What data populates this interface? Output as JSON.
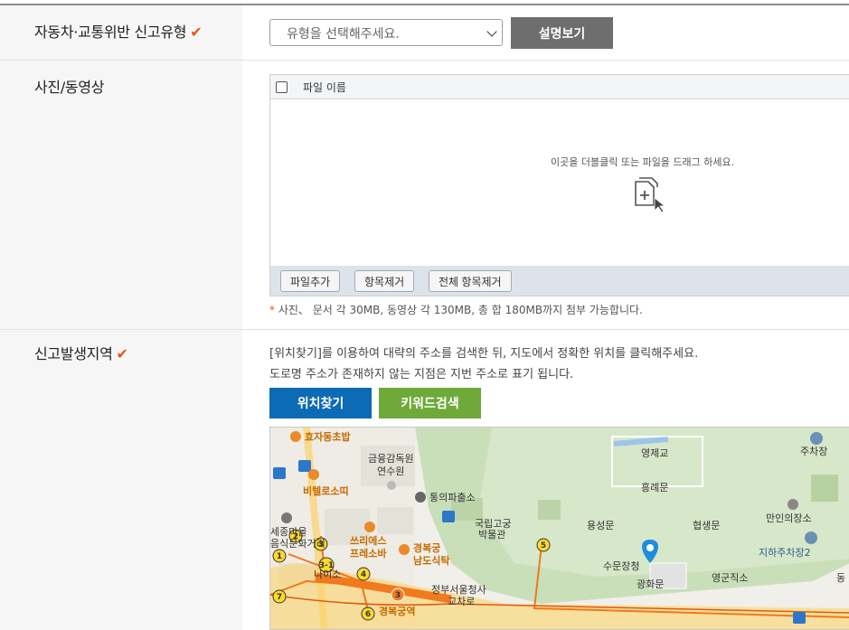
{
  "report_type": {
    "label": "자동차·교통위반 신고유형",
    "required_mark": "✔",
    "select_placeholder": "유형을 선택해주세요.",
    "explain_button": "설명보기"
  },
  "media": {
    "label": "사진/동영상",
    "column_header": "파일 이름",
    "drop_message": "이곳을 더블클릭 또는 파일을 드래그 하세요.",
    "buttons": [
      "파일추가",
      "항목제거",
      "전체 항목제거"
    ],
    "note_mark": "*",
    "note": "사진、 문서 각 30MB, 동영상 각 130MB, 총 합 180MB까지 첨부 가능합니다."
  },
  "location": {
    "label": "신고발생지역",
    "required_mark": "✔",
    "desc1": "[위치찾기]를 이용하여 대략의 주소를 검색한 뒤, 지도에서 정확한 위치를 클릭해주세요.",
    "desc2": "도로명 주소가 존재하지 않는 지점은 지번 주소로 표기 됩니다.",
    "find_button": "위치찾기",
    "keyword_button": "키워드검색"
  },
  "map": {
    "labels": {
      "hyoja": "효자동초밥",
      "geumyung": "금융감독원",
      "yeonsuwon": "연수원",
      "bitello": "비텔로소띠",
      "tongui": "통의파출소",
      "gungnip1": "국립고궁",
      "gungnip2": "박물관",
      "yeongjegyo": "영제교",
      "heungnyemun": "흥례문",
      "yongseongmun": "용성문",
      "hyeopsaengmun": "협생문",
      "sumunjang": "수문장청",
      "gwanghwamun": "광화문",
      "yeonggunjiso": "영군직소",
      "jucha1": "주차장",
      "manin": "만인의장소",
      "jucha2": "지하주차장2",
      "jjuri1": "쓰리에스",
      "jjuri2": "프레소바",
      "gbg1": "경복궁",
      "gbg2": "남도식탁",
      "jeongbu1": "정부서울청사",
      "jeongbu2": "교차로",
      "sejong1": "세종마을",
      "sejong2": "음식문화거리",
      "naeiso": "나이소",
      "gyeongbokgung": "경복궁역",
      "dong": "동"
    },
    "route_numbers": [
      "1",
      "2",
      "3",
      "3-1",
      "4",
      "5",
      "6",
      "7",
      "3"
    ]
  },
  "colors": {
    "accent_orange": "#e8541a",
    "blue_button": "#0c6bb5",
    "green_button": "#6ea93a",
    "gray_button": "#6e6e6e"
  }
}
